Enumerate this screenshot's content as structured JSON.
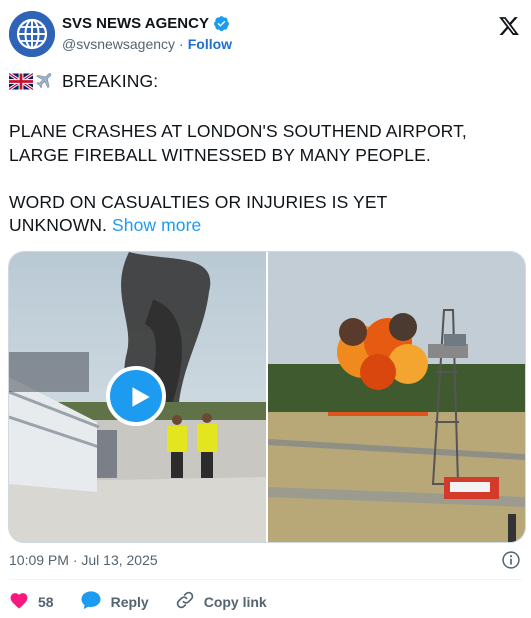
{
  "account": {
    "display_name": "SVS NEWS AGENCY",
    "handle": "@svsnewsagency",
    "separator": "·",
    "follow_label": "Follow"
  },
  "tweet": {
    "line1": "BREAKING:",
    "body": "PLANE CRASHES AT LONDON'S SOUTHEND AIRPORT,\nLARGE FIREBALL WITNESSED BY MANY PEOPLE.\n\nWORD ON CASUALTIES OR INJURIES IS YET\nUNKNOWN. ",
    "show_more_label": "Show more",
    "timestamp": "10:09 PM · Jul 13, 2025"
  },
  "actions": {
    "likes": "58",
    "reply_label": "Reply",
    "copy_link_label": "Copy link"
  },
  "icons": {
    "like": "heart-icon",
    "reply": "speech-bubble-icon",
    "copy": "link-icon",
    "info": "info-icon",
    "brand": "x-logo-icon"
  },
  "colors": {
    "accent": "#1d9bf0",
    "follow": "#1d6fd1",
    "like": "#f91880",
    "reply": "#1d9bf0",
    "muted": "#536471"
  }
}
